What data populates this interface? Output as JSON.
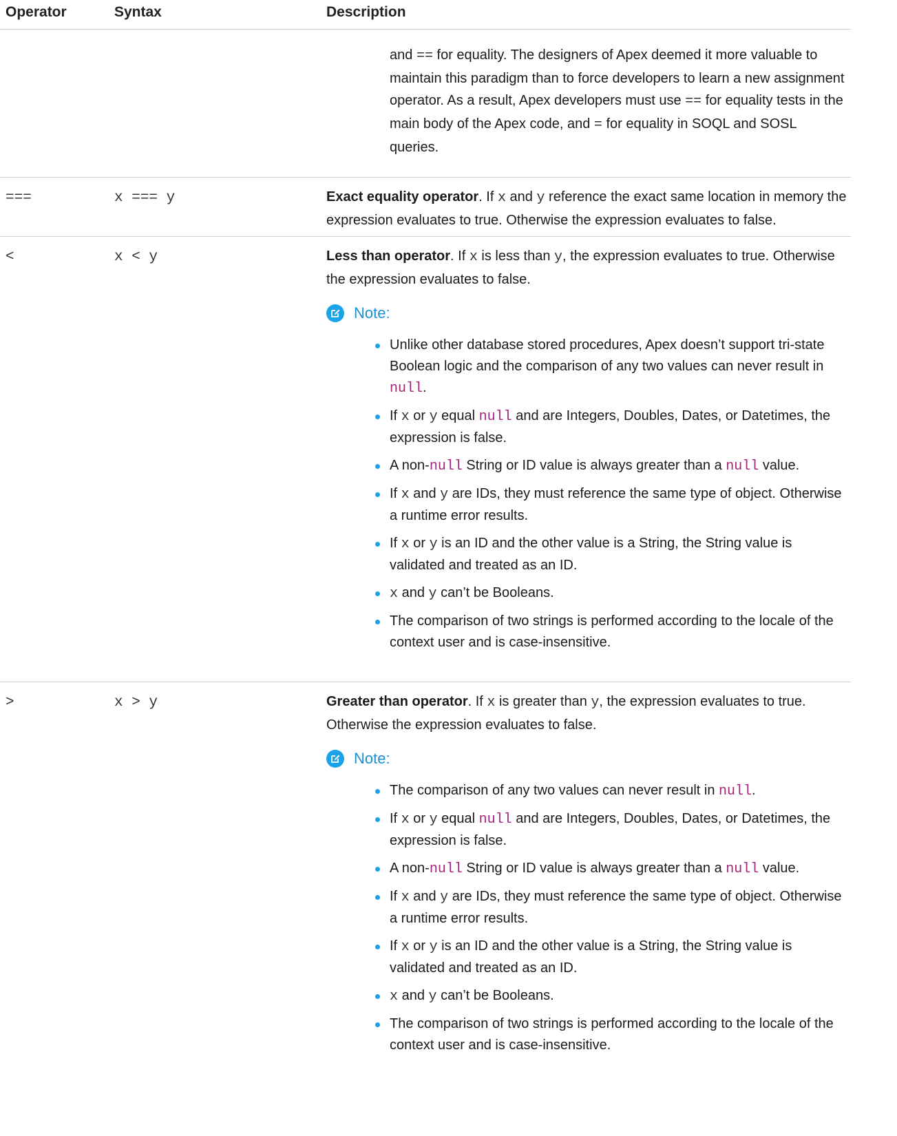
{
  "header": {
    "operator": "Operator",
    "syntax": "Syntax",
    "description": "Description"
  },
  "continuation": {
    "p1": "and ",
    "c1": "==",
    "p2": " for equality. The designers of Apex deemed it more valuable to maintain this paradigm than to force developers to learn a new assignment operator. As a result, Apex developers must use ",
    "c2": "==",
    "p3": " for equality tests in the main body of the Apex code, and ",
    "c3": "=",
    "p4": " for equality in SOQL and SOSL queries."
  },
  "exact": {
    "symbol": "===",
    "syntax": "x === y",
    "title": "Exact equality operator",
    "t1": ". If ",
    "x": "x",
    "t2": " and ",
    "y": "y",
    "t3": " reference the exact same location in memory the expression evaluates to true. Otherwise the expression evaluates to false."
  },
  "less": {
    "symbol": "<",
    "syntax": "x < y",
    "title": "Less than operator",
    "t1": ". If ",
    "x": "x",
    "t2": " is less than ",
    "y": "y",
    "t3": ", the expression evaluates to true. Otherwise the expression evaluates to false.",
    "note_label": "Note:",
    "notes": {
      "n1": {
        "a": "Unlike other database stored procedures, Apex doesn’t support tri-state Boolean logic and the comparison of any two values can never result in ",
        "null": "null",
        "b": "."
      },
      "n2": {
        "a": "If ",
        "x": "x",
        "b": " or ",
        "y": "y",
        "c": " equal ",
        "null": "null",
        "d": " and are Integers, Doubles, Dates, or Datetimes, the expression is false."
      },
      "n3": {
        "a": "A non-",
        "null1": "null",
        "b": " String or ID value is always greater than a ",
        "null2": "null",
        "c": " value."
      },
      "n4": {
        "a": "If ",
        "x": "x",
        "b": " and ",
        "y": "y",
        "c": " are IDs, they must reference the same type of object. Otherwise a runtime error results."
      },
      "n5": {
        "a": "If ",
        "x": "x",
        "b": " or ",
        "y": "y",
        "c": " is an ID and the other value is a String, the String value is validated and treated as an ID."
      },
      "n6": {
        "x": "x",
        "a": " and ",
        "y": "y",
        "b": " can’t be Booleans."
      },
      "n7": {
        "a": "The comparison of two strings is performed according to the locale of the context user and is case-insensitive."
      }
    }
  },
  "greater": {
    "symbol": ">",
    "syntax": "x > y",
    "title": "Greater than operator",
    "t1": ". If ",
    "x": "x",
    "t2": " is greater than ",
    "y": "y",
    "t3": ", the expression evaluates to true. Otherwise the expression evaluates to false.",
    "note_label": "Note:",
    "notes": {
      "n1": {
        "a": "The comparison of any two values can never result in ",
        "null": "null",
        "b": "."
      },
      "n2": {
        "a": "If ",
        "x": "x",
        "b": " or ",
        "y": "y",
        "c": " equal ",
        "null": "null",
        "d": " and are Integers, Doubles, Dates, or Datetimes, the expression is false."
      },
      "n3": {
        "a": "A non-",
        "null1": "null",
        "b": " String or ID value is always greater than a ",
        "null2": "null",
        "c": " value."
      },
      "n4": {
        "a": "If ",
        "x": "x",
        "b": " and ",
        "y": "y",
        "c": " are IDs, they must reference the same type of object. Otherwise a runtime error results."
      },
      "n5": {
        "a": "If ",
        "x": "x",
        "b": " or ",
        "y": "y",
        "c": " is an ID and the other value is a String, the String value is validated and treated as an ID."
      },
      "n6": {
        "x": "x",
        "a": " and ",
        "y": "y",
        "b": " can’t be Booleans."
      },
      "n7": {
        "a": "The comparison of two strings is performed according to the locale of the context user and is case-insensitive."
      }
    }
  },
  "colors": {
    "accent": "#1aa3e8",
    "null_code": "#a3237b",
    "rule": "#cfcfcf"
  },
  "icons": {
    "note": "edit-note-icon"
  }
}
